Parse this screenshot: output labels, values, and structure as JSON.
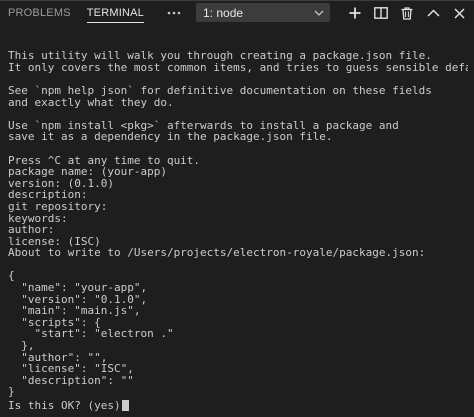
{
  "tabs": {
    "problems": "PROBLEMS",
    "terminal": "TERMINAL"
  },
  "terminal_selector": {
    "value": "1: node"
  },
  "icons": {
    "more": "more-horizontal-icon",
    "add": "plus-icon",
    "split": "split-terminal-icon",
    "kill": "trash-icon",
    "maximize": "chevron-up-icon",
    "close": "close-icon"
  },
  "colors": {
    "background": "#1e1e1e",
    "text": "#cccccc",
    "tab_active": "#e7e7e7",
    "tab_inactive": "#9d9d9d",
    "select_bg": "#3c3c3c"
  },
  "terminal": {
    "lines": [
      "This utility will walk you through creating a package.json file.",
      "It only covers the most common items, and tries to guess sensible defaults.",
      "",
      "See `npm help json` for definitive documentation on these fields",
      "and exactly what they do.",
      "",
      "Use `npm install <pkg>` afterwards to install a package and",
      "save it as a dependency in the package.json file.",
      "",
      "Press ^C at any time to quit.",
      "package name: (your-app)",
      "version: (0.1.0)",
      "description:",
      "git repository:",
      "keywords:",
      "author:",
      "license: (ISC)",
      "About to write to /Users/projects/electron-royale/package.json:",
      "",
      "{",
      "  \"name\": \"your-app\",",
      "  \"version\": \"0.1.0\",",
      "  \"main\": \"main.js\",",
      "  \"scripts\": {",
      "    \"start\": \"electron .\"",
      "  },",
      "  \"author\": \"\",",
      "  \"license\": \"ISC\",",
      "  \"description\": \"\"",
      "}"
    ],
    "prompt": "Is this OK? (yes)"
  }
}
